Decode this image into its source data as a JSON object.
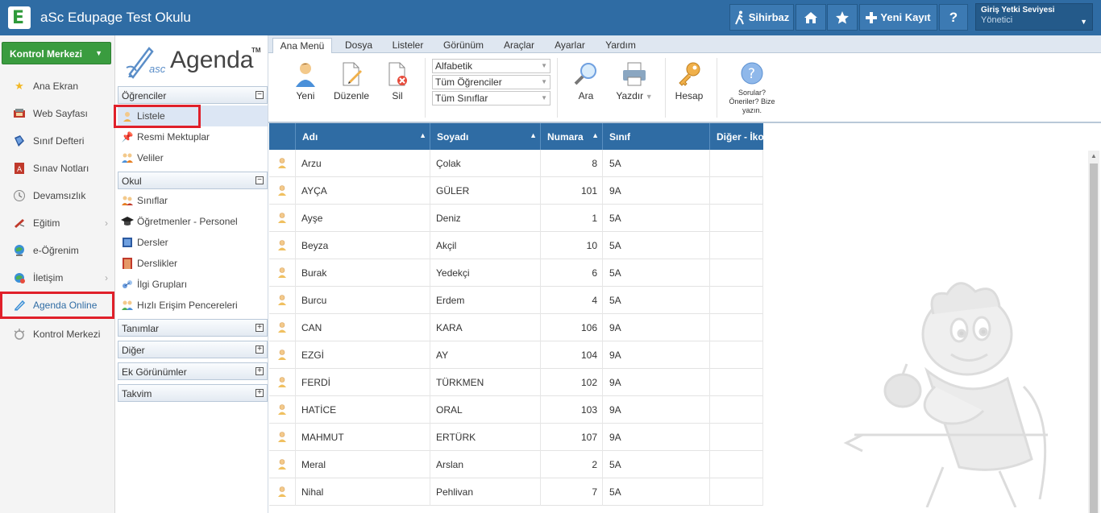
{
  "app": {
    "logo_letter": "E",
    "title": "aSc Edupage Test Okulu"
  },
  "topbar": {
    "sihirbaz": "Sihirbaz",
    "yeni_kayit": "Yeni Kayıt",
    "help": "?",
    "user_label": "Giriş Yetki Seviyesi",
    "user_value": "Yönetici"
  },
  "leftnav": {
    "control_button": "Kontrol Merkezi",
    "items": [
      {
        "label": "Ana Ekran",
        "icon": "star-icon"
      },
      {
        "label": "Web Sayfası",
        "icon": "web-icon"
      },
      {
        "label": "Sınıf Defteri",
        "icon": "book-icon"
      },
      {
        "label": "Sınav Notları",
        "icon": "grades-icon"
      },
      {
        "label": "Devamsızlık",
        "icon": "clock-icon"
      },
      {
        "label": "Eğitim",
        "icon": "education-icon"
      },
      {
        "label": "e-Öğrenim",
        "icon": "elearning-icon"
      },
      {
        "label": "İletişim",
        "icon": "communication-icon"
      },
      {
        "label": "Agenda Online",
        "icon": "agenda-icon"
      },
      {
        "label": "Kontrol Merkezi",
        "icon": "control-icon"
      }
    ]
  },
  "panel": {
    "logo_prefix": "asc",
    "logo_text": "Agenda",
    "logo_tm": "TM",
    "sections": {
      "ogrenciler": "Öğrenciler",
      "okul": "Okul",
      "tanimlar": "Tanımlar",
      "diger": "Diğer",
      "ek": "Ek Görünümler",
      "takvim": "Takvim"
    },
    "ogrenci_items": [
      "Listele",
      "Resmi Mektuplar",
      "Veliler"
    ],
    "okul_items": [
      "Sınıflar",
      "Öğretmenler - Personel",
      "Dersler",
      "Derslikler",
      "İlgi Grupları",
      "Hızlı Erişim Pencereleri"
    ]
  },
  "ribbon": {
    "tabs": [
      "Ana Menü",
      "Dosya",
      "Listeler",
      "Görünüm",
      "Araçlar",
      "Ayarlar",
      "Yardım"
    ],
    "buttons": {
      "yeni": "Yeni",
      "duzenle": "Düzenle",
      "sil": "Sil",
      "ara": "Ara",
      "yazdir": "Yazdır",
      "hesap": "Hesap"
    },
    "help_text": "Sorular? Öneriler? Bize yazın.",
    "selects": [
      "Alfabetik",
      "Tüm Öğrenciler",
      "Tüm Sınıflar"
    ]
  },
  "table": {
    "headers": {
      "adi": "Adı",
      "soyadi": "Soyadı",
      "numara": "Numara",
      "sinif": "Sınıf",
      "diger": "Diğer - İko"
    },
    "rows": [
      {
        "adi": "Arzu",
        "soyadi": "Çolak",
        "numara": "8",
        "sinif": "5A"
      },
      {
        "adi": "AYÇA",
        "soyadi": "GÜLER",
        "numara": "101",
        "sinif": "9A"
      },
      {
        "adi": "Ayşe",
        "soyadi": "Deniz",
        "numara": "1",
        "sinif": "5A"
      },
      {
        "adi": "Beyza",
        "soyadi": "Akçil",
        "numara": "10",
        "sinif": "5A"
      },
      {
        "adi": "Burak",
        "soyadi": "Yedekçi",
        "numara": "6",
        "sinif": "5A"
      },
      {
        "adi": "Burcu",
        "soyadi": "Erdem",
        "numara": "4",
        "sinif": "5A"
      },
      {
        "adi": "CAN",
        "soyadi": "KARA",
        "numara": "106",
        "sinif": "9A"
      },
      {
        "adi": "EZGİ",
        "soyadi": "AY",
        "numara": "104",
        "sinif": "9A"
      },
      {
        "adi": "FERDİ",
        "soyadi": "TÜRKMEN",
        "numara": "102",
        "sinif": "9A"
      },
      {
        "adi": "HATİCE",
        "soyadi": "ORAL",
        "numara": "103",
        "sinif": "9A"
      },
      {
        "adi": "MAHMUT",
        "soyadi": "ERTÜRK",
        "numara": "107",
        "sinif": "9A"
      },
      {
        "adi": "Meral",
        "soyadi": "Arslan",
        "numara": "2",
        "sinif": "5A"
      },
      {
        "adi": "Nihal",
        "soyadi": "Pehlivan",
        "numara": "7",
        "sinif": "5A"
      }
    ]
  },
  "colors": {
    "brand": "#2f6ca4",
    "green": "#3a9c3f",
    "highlight": "#e0202a"
  }
}
